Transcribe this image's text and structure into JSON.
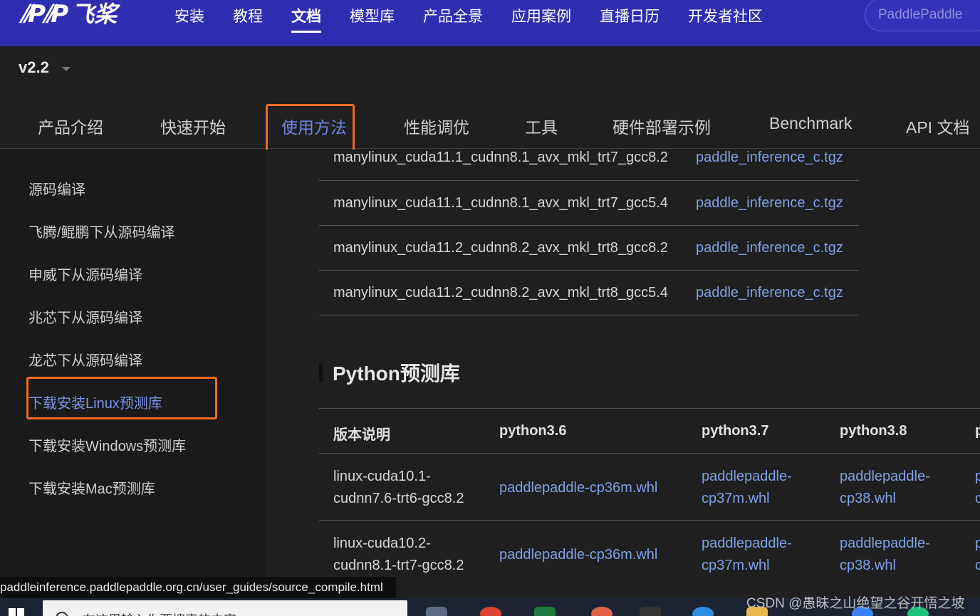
{
  "topnav": {
    "logo_text": "飞桨",
    "items": [
      {
        "label": "安装"
      },
      {
        "label": "教程"
      },
      {
        "label": "文档",
        "active": true
      },
      {
        "label": "模型库"
      },
      {
        "label": "产品全景"
      },
      {
        "label": "应用案例"
      },
      {
        "label": "直播日历"
      },
      {
        "label": "开发者社区"
      }
    ],
    "search_placeholder": "PaddlePaddle"
  },
  "version": {
    "label": "v2.2"
  },
  "subtabs": [
    {
      "label": "产品介绍"
    },
    {
      "label": "快速开始"
    },
    {
      "label": "使用方法",
      "active": true
    },
    {
      "label": "性能调优"
    },
    {
      "label": "工具"
    },
    {
      "label": "硬件部署示例"
    },
    {
      "label": "Benchmark"
    },
    {
      "label": "API 文档"
    }
  ],
  "sidebar": {
    "items": [
      {
        "label": "源码编译"
      },
      {
        "label": "飞腾/鲲鹏下从源码编译"
      },
      {
        "label": "申威下从源码编译"
      },
      {
        "label": "兆芯下从源码编译"
      },
      {
        "label": "龙芯下从源码编译"
      },
      {
        "label": "下载安装Linux预测库",
        "active": true
      },
      {
        "label": "下载安装Windows预测库"
      },
      {
        "label": "下载安装Mac预测库"
      }
    ]
  },
  "c_table": {
    "rows": [
      {
        "name": "manylinux_cuda11.1_cudnn8.1_avx_mkl_trt7_gcc8.2",
        "link": "paddle_inference_c.tgz"
      },
      {
        "name": "manylinux_cuda11.1_cudnn8.1_avx_mkl_trt7_gcc5.4",
        "link": "paddle_inference_c.tgz"
      },
      {
        "name": "manylinux_cuda11.2_cudnn8.2_avx_mkl_trt8_gcc8.2",
        "link": "paddle_inference_c.tgz"
      },
      {
        "name": "manylinux_cuda11.2_cudnn8.2_avx_mkl_trt8_gcc5.4",
        "link": "paddle_inference_c.tgz"
      }
    ]
  },
  "python_section": {
    "title": "Python预测库",
    "headers": [
      "版本说明",
      "python3.6",
      "python3.7",
      "python3.8",
      "p"
    ],
    "rows": [
      {
        "version_line1": "linux-cuda10.1-",
        "version_line2": "cudnn7.6-trt6-gcc8.2",
        "py36": "paddlepaddle-cp36m.whl",
        "py37_line1": "paddlepaddle-",
        "py37_line2": "cp37m.whl",
        "py38_line1": "paddlepaddle-",
        "py38_line2": "cp38.whl",
        "py39_line1": "p",
        "py39_line2": "c"
      },
      {
        "version_line1": "linux-cuda10.2-",
        "version_line2": "cudnn8.1-trt7-gcc8.2",
        "py36": "paddlepaddle-cp36m.whl",
        "py37_line1": "paddlepaddle-",
        "py37_line2": "cp37m.whl",
        "py38_line1": "paddlepaddle-",
        "py38_line2": "cp38.whl",
        "py39_line1": "p",
        "py39_line2": "c"
      }
    ]
  },
  "status_url": "paddleinference.paddlepaddle.org.cn/user_guides/source_compile.html",
  "watermark": "CSDN @愚昧之山绝望之谷开悟之坡",
  "taskbar": {
    "search_placeholder": "在这里输入你要搜索的内容"
  }
}
